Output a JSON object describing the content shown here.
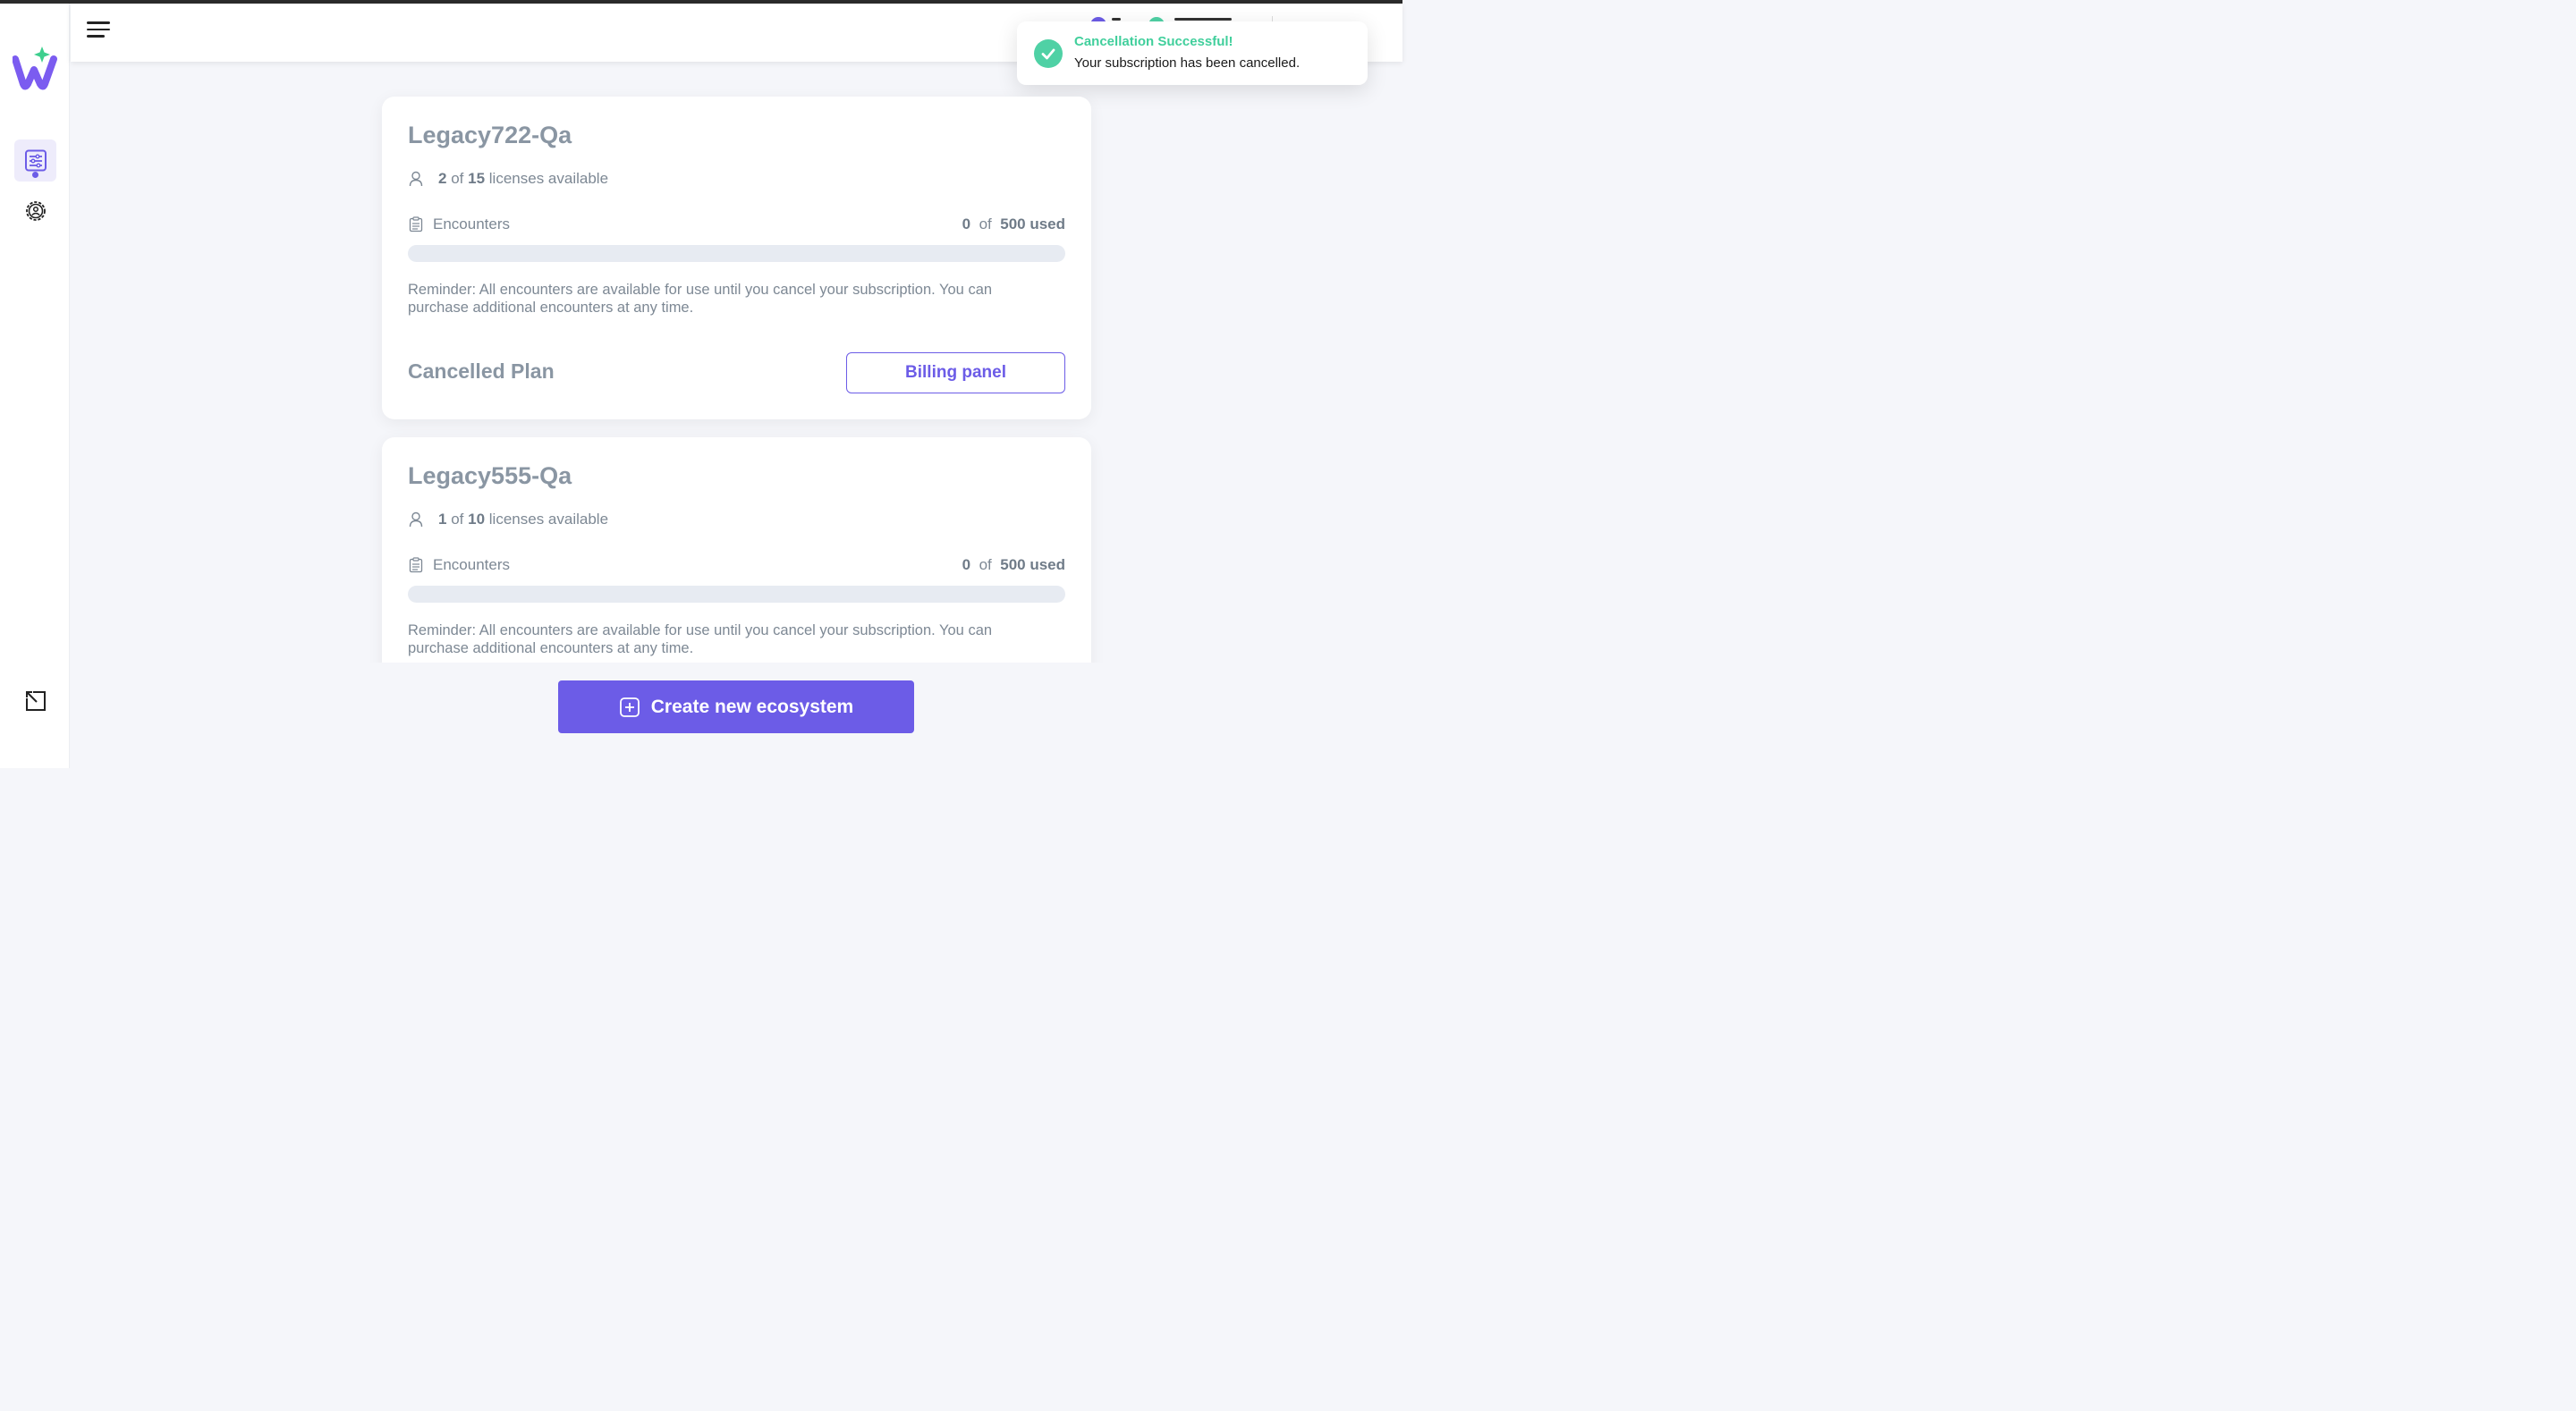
{
  "toast": {
    "title": "Cancellation Successful!",
    "message": "Your subscription has been cancelled."
  },
  "colors": {
    "accent": "#6c5ce7",
    "success": "#41cf9c",
    "muted_text": "#7d8894"
  },
  "nav": {
    "items": [
      {
        "icon": "subscriptions-icon",
        "active": true
      },
      {
        "icon": "gear-icon",
        "active": false
      },
      {
        "icon": "export-icon",
        "active": false
      }
    ]
  },
  "cards": [
    {
      "title": "Legacy722-Qa",
      "licenses_used": "2",
      "licenses_of": "of",
      "licenses_total": "15",
      "licenses_suffix": "licenses available",
      "encounters_label": "Encounters",
      "encounters_used": "0",
      "encounters_of": "of",
      "encounters_total": "500 used",
      "encounters_progress": 0,
      "reminder": "Reminder: All encounters are available for use until you cancel your subscription. You can purchase additional encounters at any time.",
      "plan_status": "Cancelled Plan",
      "billing_button": "Billing panel"
    },
    {
      "title": "Legacy555-Qa",
      "licenses_used": "1",
      "licenses_of": "of",
      "licenses_total": "10",
      "licenses_suffix": "licenses available",
      "encounters_label": "Encounters",
      "encounters_used": "0",
      "encounters_of": "of",
      "encounters_total": "500 used",
      "encounters_progress": 0,
      "reminder": "Reminder: All encounters are available for use until you cancel your subscription. You can purchase additional encounters at any time."
    }
  ],
  "create_button": "Create new ecosystem"
}
